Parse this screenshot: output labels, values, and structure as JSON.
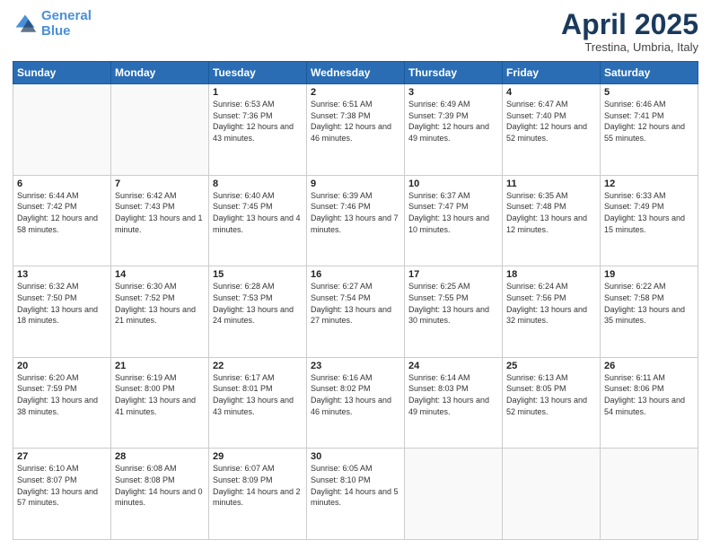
{
  "header": {
    "logo_line1": "General",
    "logo_line2": "Blue",
    "title": "April 2025",
    "subtitle": "Trestina, Umbria, Italy"
  },
  "columns": [
    "Sunday",
    "Monday",
    "Tuesday",
    "Wednesday",
    "Thursday",
    "Friday",
    "Saturday"
  ],
  "weeks": [
    [
      {
        "day": "",
        "sunrise": "",
        "sunset": "",
        "daylight": ""
      },
      {
        "day": "",
        "sunrise": "",
        "sunset": "",
        "daylight": ""
      },
      {
        "day": "1",
        "sunrise": "Sunrise: 6:53 AM",
        "sunset": "Sunset: 7:36 PM",
        "daylight": "Daylight: 12 hours and 43 minutes."
      },
      {
        "day": "2",
        "sunrise": "Sunrise: 6:51 AM",
        "sunset": "Sunset: 7:38 PM",
        "daylight": "Daylight: 12 hours and 46 minutes."
      },
      {
        "day": "3",
        "sunrise": "Sunrise: 6:49 AM",
        "sunset": "Sunset: 7:39 PM",
        "daylight": "Daylight: 12 hours and 49 minutes."
      },
      {
        "day": "4",
        "sunrise": "Sunrise: 6:47 AM",
        "sunset": "Sunset: 7:40 PM",
        "daylight": "Daylight: 12 hours and 52 minutes."
      },
      {
        "day": "5",
        "sunrise": "Sunrise: 6:46 AM",
        "sunset": "Sunset: 7:41 PM",
        "daylight": "Daylight: 12 hours and 55 minutes."
      }
    ],
    [
      {
        "day": "6",
        "sunrise": "Sunrise: 6:44 AM",
        "sunset": "Sunset: 7:42 PM",
        "daylight": "Daylight: 12 hours and 58 minutes."
      },
      {
        "day": "7",
        "sunrise": "Sunrise: 6:42 AM",
        "sunset": "Sunset: 7:43 PM",
        "daylight": "Daylight: 13 hours and 1 minute."
      },
      {
        "day": "8",
        "sunrise": "Sunrise: 6:40 AM",
        "sunset": "Sunset: 7:45 PM",
        "daylight": "Daylight: 13 hours and 4 minutes."
      },
      {
        "day": "9",
        "sunrise": "Sunrise: 6:39 AM",
        "sunset": "Sunset: 7:46 PM",
        "daylight": "Daylight: 13 hours and 7 minutes."
      },
      {
        "day": "10",
        "sunrise": "Sunrise: 6:37 AM",
        "sunset": "Sunset: 7:47 PM",
        "daylight": "Daylight: 13 hours and 10 minutes."
      },
      {
        "day": "11",
        "sunrise": "Sunrise: 6:35 AM",
        "sunset": "Sunset: 7:48 PM",
        "daylight": "Daylight: 13 hours and 12 minutes."
      },
      {
        "day": "12",
        "sunrise": "Sunrise: 6:33 AM",
        "sunset": "Sunset: 7:49 PM",
        "daylight": "Daylight: 13 hours and 15 minutes."
      }
    ],
    [
      {
        "day": "13",
        "sunrise": "Sunrise: 6:32 AM",
        "sunset": "Sunset: 7:50 PM",
        "daylight": "Daylight: 13 hours and 18 minutes."
      },
      {
        "day": "14",
        "sunrise": "Sunrise: 6:30 AM",
        "sunset": "Sunset: 7:52 PM",
        "daylight": "Daylight: 13 hours and 21 minutes."
      },
      {
        "day": "15",
        "sunrise": "Sunrise: 6:28 AM",
        "sunset": "Sunset: 7:53 PM",
        "daylight": "Daylight: 13 hours and 24 minutes."
      },
      {
        "day": "16",
        "sunrise": "Sunrise: 6:27 AM",
        "sunset": "Sunset: 7:54 PM",
        "daylight": "Daylight: 13 hours and 27 minutes."
      },
      {
        "day": "17",
        "sunrise": "Sunrise: 6:25 AM",
        "sunset": "Sunset: 7:55 PM",
        "daylight": "Daylight: 13 hours and 30 minutes."
      },
      {
        "day": "18",
        "sunrise": "Sunrise: 6:24 AM",
        "sunset": "Sunset: 7:56 PM",
        "daylight": "Daylight: 13 hours and 32 minutes."
      },
      {
        "day": "19",
        "sunrise": "Sunrise: 6:22 AM",
        "sunset": "Sunset: 7:58 PM",
        "daylight": "Daylight: 13 hours and 35 minutes."
      }
    ],
    [
      {
        "day": "20",
        "sunrise": "Sunrise: 6:20 AM",
        "sunset": "Sunset: 7:59 PM",
        "daylight": "Daylight: 13 hours and 38 minutes."
      },
      {
        "day": "21",
        "sunrise": "Sunrise: 6:19 AM",
        "sunset": "Sunset: 8:00 PM",
        "daylight": "Daylight: 13 hours and 41 minutes."
      },
      {
        "day": "22",
        "sunrise": "Sunrise: 6:17 AM",
        "sunset": "Sunset: 8:01 PM",
        "daylight": "Daylight: 13 hours and 43 minutes."
      },
      {
        "day": "23",
        "sunrise": "Sunrise: 6:16 AM",
        "sunset": "Sunset: 8:02 PM",
        "daylight": "Daylight: 13 hours and 46 minutes."
      },
      {
        "day": "24",
        "sunrise": "Sunrise: 6:14 AM",
        "sunset": "Sunset: 8:03 PM",
        "daylight": "Daylight: 13 hours and 49 minutes."
      },
      {
        "day": "25",
        "sunrise": "Sunrise: 6:13 AM",
        "sunset": "Sunset: 8:05 PM",
        "daylight": "Daylight: 13 hours and 52 minutes."
      },
      {
        "day": "26",
        "sunrise": "Sunrise: 6:11 AM",
        "sunset": "Sunset: 8:06 PM",
        "daylight": "Daylight: 13 hours and 54 minutes."
      }
    ],
    [
      {
        "day": "27",
        "sunrise": "Sunrise: 6:10 AM",
        "sunset": "Sunset: 8:07 PM",
        "daylight": "Daylight: 13 hours and 57 minutes."
      },
      {
        "day": "28",
        "sunrise": "Sunrise: 6:08 AM",
        "sunset": "Sunset: 8:08 PM",
        "daylight": "Daylight: 14 hours and 0 minutes."
      },
      {
        "day": "29",
        "sunrise": "Sunrise: 6:07 AM",
        "sunset": "Sunset: 8:09 PM",
        "daylight": "Daylight: 14 hours and 2 minutes."
      },
      {
        "day": "30",
        "sunrise": "Sunrise: 6:05 AM",
        "sunset": "Sunset: 8:10 PM",
        "daylight": "Daylight: 14 hours and 5 minutes."
      },
      {
        "day": "",
        "sunrise": "",
        "sunset": "",
        "daylight": ""
      },
      {
        "day": "",
        "sunrise": "",
        "sunset": "",
        "daylight": ""
      },
      {
        "day": "",
        "sunrise": "",
        "sunset": "",
        "daylight": ""
      }
    ]
  ]
}
